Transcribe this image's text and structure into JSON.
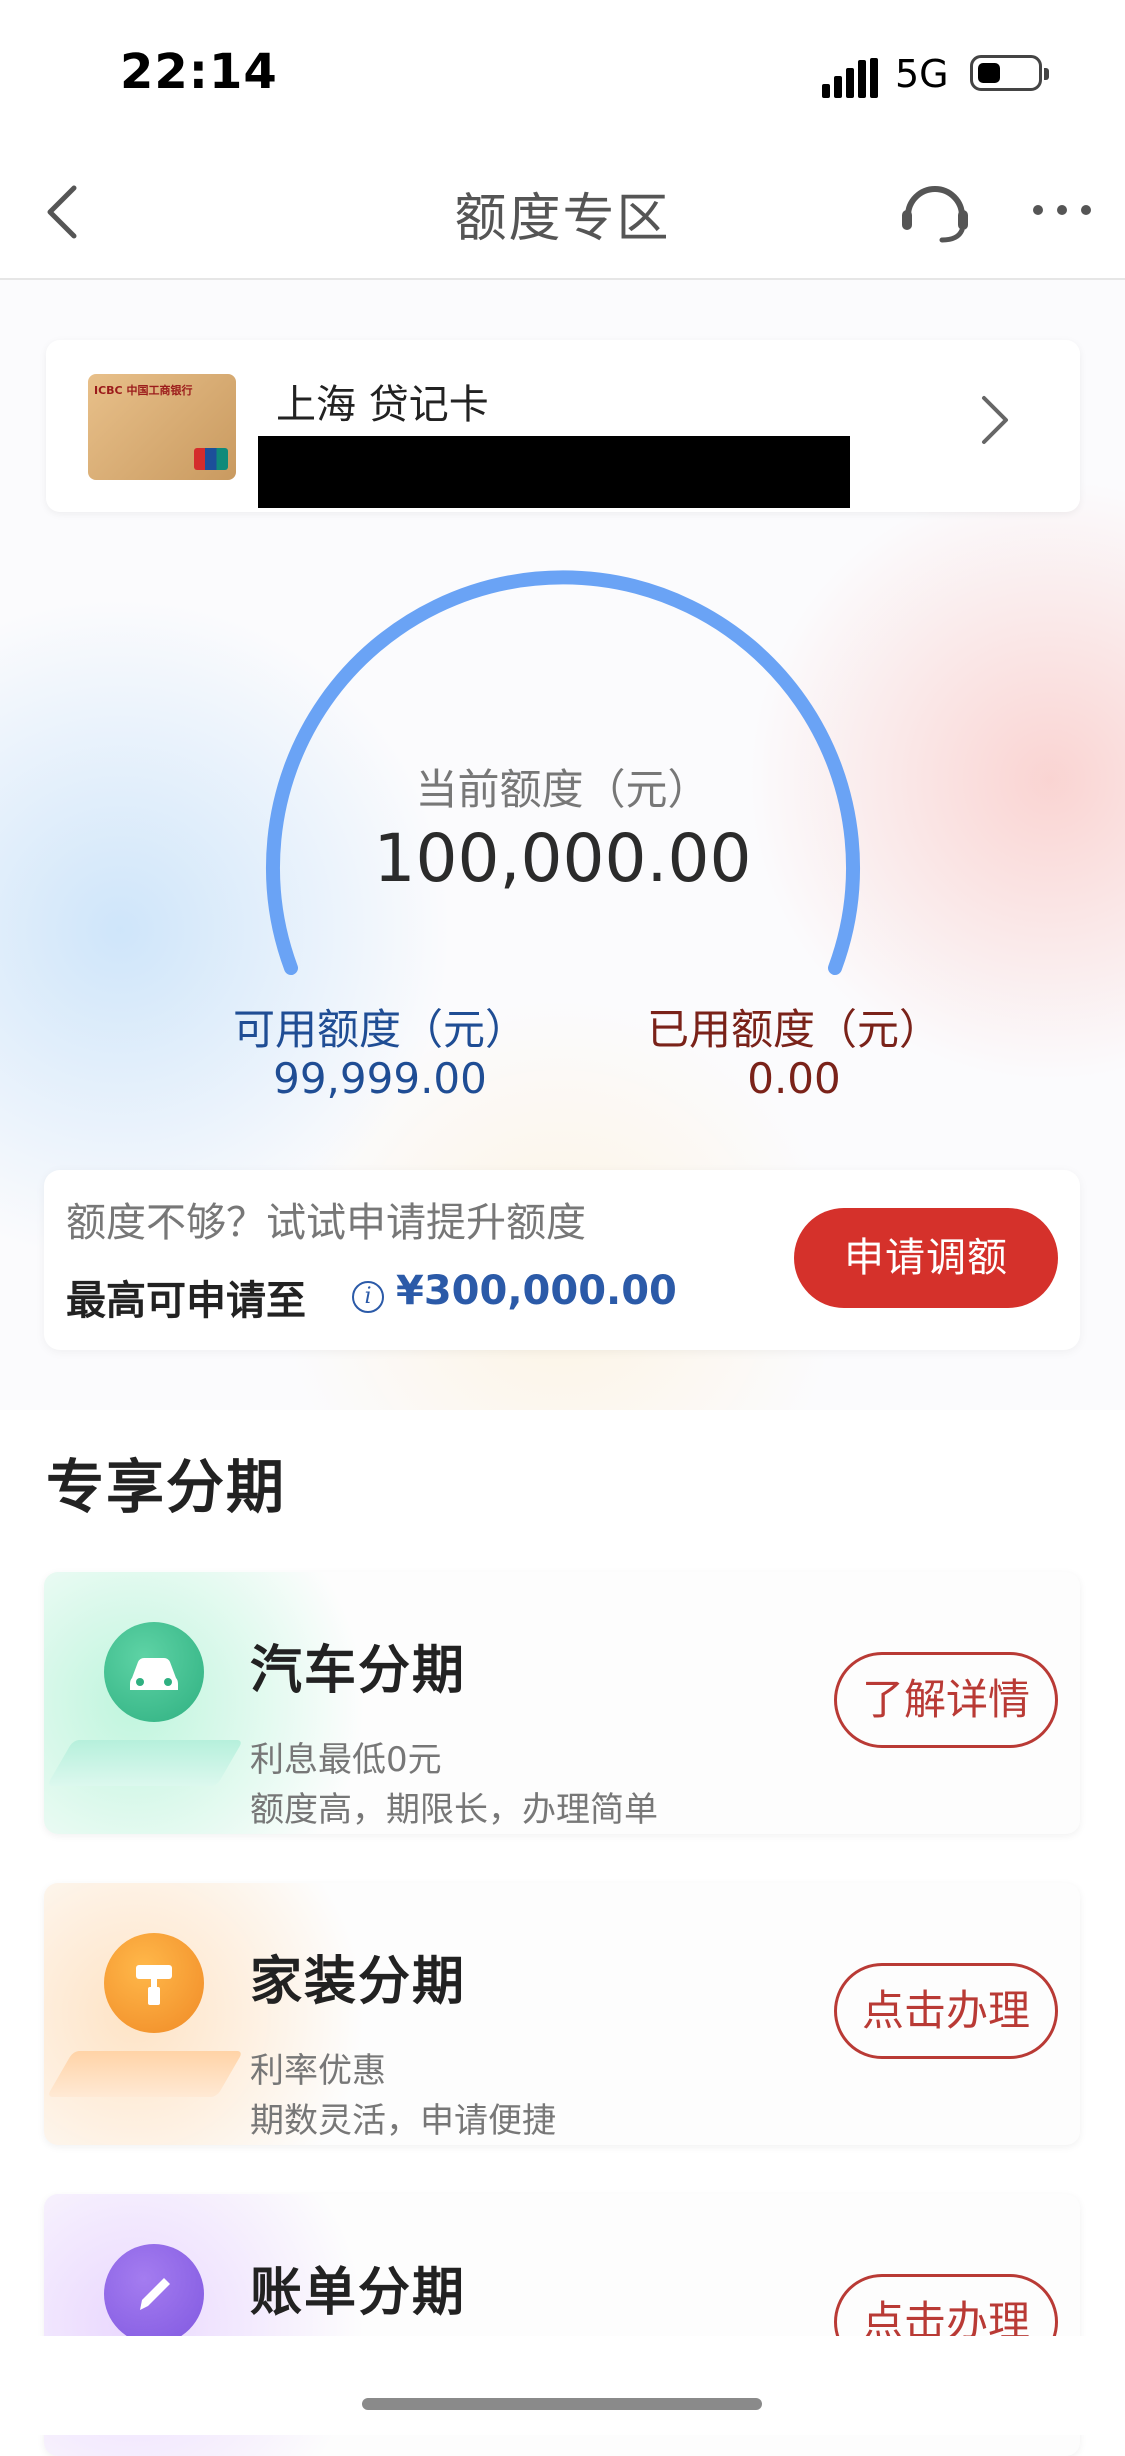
{
  "status_bar": {
    "time": "22:14",
    "network": "5G",
    "signal_icon": "signal-bars-icon",
    "battery_icon": "battery-icon"
  },
  "nav": {
    "title": "额度专区",
    "back_icon": "chevron-left-icon",
    "service_icon": "headset-icon",
    "more_icon": "more-dots-icon"
  },
  "card": {
    "name": "上海 贷记卡",
    "arrow_icon": "chevron-right-icon"
  },
  "credit": {
    "current_label": "当前额度（元）",
    "current_amount": "100,000.00",
    "available_label": "可用额度（元）",
    "available_amount": "99,999.00",
    "used_label": "已用额度（元）",
    "used_amount": "0.00",
    "used_fraction": 0.0
  },
  "promo": {
    "line1": "额度不够？试试申请提升额度",
    "line2_prefix": "最高可申请至",
    "info_icon": "info-icon",
    "max_amount": "¥300,000.00",
    "button": "申请调额"
  },
  "section": {
    "title": "专享分期",
    "items": [
      {
        "title": "汽车分期",
        "sub1": "利息最低0元",
        "sub2": "额度高，期限长，办理简单",
        "button": "了解详情",
        "icon": "car-icon"
      },
      {
        "title": "家装分期",
        "sub1": "利率优惠",
        "sub2": "期数灵活，申请便捷",
        "button": "点击办理",
        "icon": "paint-roller-icon"
      },
      {
        "title": "账单分期",
        "button": "点击办理",
        "icon": "pencil-icon"
      }
    ]
  },
  "colors": {
    "accent_red": "#d5312b",
    "available_blue": "#1f4d94",
    "used_brown": "#7a2219",
    "gauge_blue": "#6aa3f5"
  }
}
